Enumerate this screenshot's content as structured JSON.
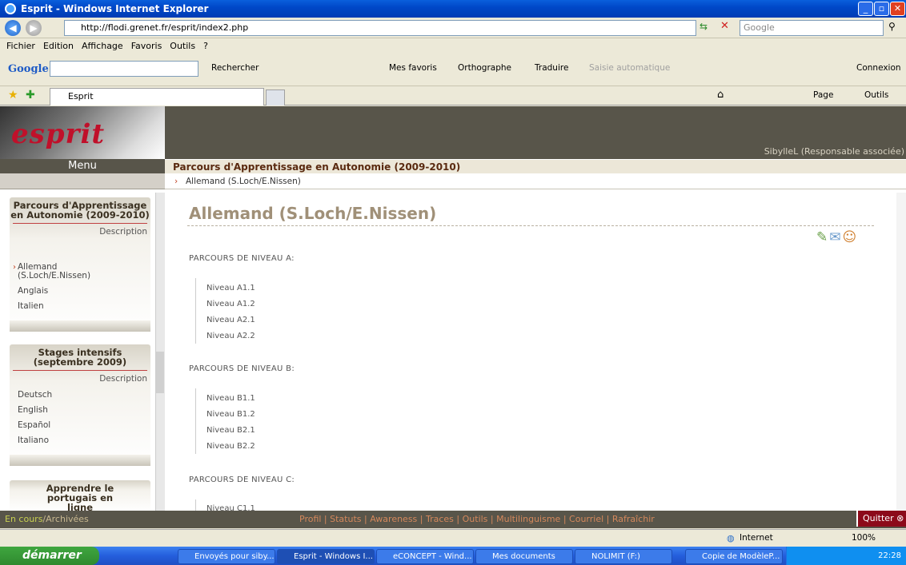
{
  "window": {
    "title": "Esprit - Windows Internet Explorer"
  },
  "address": {
    "url": "http://flodi.grenet.fr/esprit/index2.php",
    "search_placeholder": "Google"
  },
  "menu": [
    "Fichier",
    "Edition",
    "Affichage",
    "Favoris",
    "Outils",
    "?"
  ],
  "google_bar": {
    "logo": "Google",
    "rechercher": "Rechercher",
    "mes_favoris": "Mes favoris",
    "orthographe": "Orthographe",
    "traduire": "Traduire",
    "saisie": "Saisie automatique",
    "connexion": "Connexion"
  },
  "tabs": {
    "active": "Esprit",
    "page": "Page",
    "outils": "Outils"
  },
  "site": {
    "logo": "esprit",
    "user": "SibylleL (Responsable associée)",
    "menu_label": "Menu",
    "course_title": "Parcours d'Apprentissage en Autonomie (2009-2010)",
    "breadcrumb": "Allemand (S.Loch/E.Nissen)"
  },
  "sidebar": {
    "card1": {
      "title": "Parcours d'Apprentissage en Autonomie (2009-2010)",
      "description": "Description",
      "items": [
        "Allemand (S.Loch/E.Nissen)",
        "Anglais",
        "Italien"
      ]
    },
    "card2": {
      "title": "Stages intensifs (septembre 2009)",
      "description": "Description",
      "items": [
        "Deutsch",
        "English",
        "Español",
        "Italiano"
      ]
    },
    "card3": {
      "title": "Apprendre le portugais en ligne"
    }
  },
  "main": {
    "title": "Allemand (S.Loch/E.Nissen)",
    "sections": [
      {
        "heading": "PARCOURS DE NIVEAU A:",
        "levels": [
          "Niveau A1.1",
          "Niveau A1.2",
          "Niveau A2.1",
          "Niveau A2.2"
        ]
      },
      {
        "heading": "PARCOURS DE NIVEAU B:",
        "levels": [
          "Niveau B1.1",
          "Niveau B1.2",
          "Niveau B2.1",
          "Niveau B2.2"
        ]
      },
      {
        "heading": "PARCOURS DE NIVEAU C:",
        "levels": [
          "Niveau C1.1"
        ]
      }
    ]
  },
  "footer": {
    "en_cours": "En cours",
    "archivees": "/Archivées",
    "links": [
      "Profil",
      "Statuts",
      "Awareness",
      "Traces",
      "Outils",
      "Multilinguisme",
      "Courriel",
      "Rafraîchir"
    ],
    "quit": "Quitter"
  },
  "ie_status": {
    "zone": "Internet",
    "zoom": "100%"
  },
  "taskbar": {
    "start": "démarrer",
    "tasks": [
      "Envoyés pour siby...",
      "Esprit - Windows I...",
      "eCONCEPT - Wind...",
      "Mes documents",
      "NOLIMIT (F:)",
      "Copie de ModèleP..."
    ],
    "clock": "22:28"
  }
}
